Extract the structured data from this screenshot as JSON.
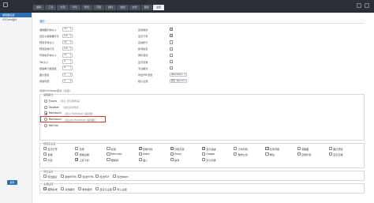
{
  "top_tabs": [
    {
      "label": "编辑",
      "active": false
    },
    {
      "label": "工具",
      "active": false
    },
    {
      "label": "外观",
      "active": false
    },
    {
      "label": "评论",
      "active": false
    },
    {
      "label": "预览",
      "active": false
    },
    {
      "label": "高级",
      "active": false
    },
    {
      "label": "插件",
      "active": false
    },
    {
      "label": "快捷",
      "active": false
    },
    {
      "label": "文件",
      "active": false
    },
    {
      "label": "图床",
      "active": false
    },
    {
      "label": "设置",
      "active": true
    }
  ],
  "sidebar": {
    "items": [
      "编辑器设置",
      "VSCode插件"
    ]
  },
  "main": {
    "section_title": "通用",
    "left_fields": [
      {
        "label": "编辑器字体大小",
        "value": "14"
      },
      {
        "label": "自定义编辑器行高",
        "value": "1.6"
      },
      {
        "label": "预览字体大小",
        "value": "14"
      },
      {
        "label": "预览区域行高",
        "value": "1.6"
      },
      {
        "label": "代码块字体大小",
        "value": "13"
      },
      {
        "label": "Tab大小",
        "value": "4"
      },
      {
        "label": "表格单元格宽度",
        "value": "0"
      },
      {
        "label": "图片宽度",
        "value": "0"
      },
      {
        "label": "表格列宽",
        "value": "0"
      }
    ],
    "right_fields": [
      {
        "label": "自动保存",
        "type": "check",
        "checked": true
      },
      {
        "label": "显示行号",
        "type": "check",
        "checked": true
      },
      {
        "label": "自动折行",
        "type": "check",
        "checked": false
      },
      {
        "label": "拼写检查",
        "type": "check",
        "checked": false
      },
      {
        "label": "同步滚动",
        "type": "check",
        "checked": false
      },
      {
        "label": "显示目录",
        "type": "check",
        "checked": false
      },
      {
        "label": "专注模式",
        "type": "check",
        "checked": false
      },
      {
        "label": "导出PDF纸张",
        "type": "select",
        "value": "Markdown"
      },
      {
        "label": "默认主题",
        "type": "select",
        "value": "默认 Typora"
      }
    ],
    "note": "选择Markdown模式（必选）",
    "mode_legend": "编辑模式",
    "modes": [
      {
        "name": "Typora",
        "desc": "（默认 所见即所得）",
        "selected": false
      },
      {
        "name": "Obsidian",
        "desc": "（双栏实时预览）",
        "selected": false
      },
      {
        "name": "Markdown",
        "desc": "（默认 Markdown 编辑器）",
        "selected": true
      },
      {
        "name": "Markdown",
        "desc": "（纯文本 Markdown 编辑器）",
        "selected": false
      },
      {
        "name": "WeChat",
        "desc": "",
        "selected": false
      }
    ],
    "options_legend": "预览区设置",
    "options": [
      {
        "label": "显示行号",
        "checked": false
      },
      {
        "label": "目录",
        "checked": false
      },
      {
        "label": "标题",
        "checked": false
      },
      {
        "label": "复制代码",
        "checked": true
      },
      {
        "label": "代码高亮",
        "checked": true
      },
      {
        "label": "显示语言",
        "checked": true
      },
      {
        "label": "行内代码",
        "checked": false
      },
      {
        "label": "任务列表",
        "checked": true
      },
      {
        "label": "流程图",
        "checked": false
      },
      {
        "label": "图片预览",
        "checked": false
      },
      {
        "label": "表格",
        "checked": false
      },
      {
        "label": "表格边框",
        "checked": false
      },
      {
        "label": "Mermaid",
        "checked": false
      },
      {
        "label": "Katex",
        "checked": false
      },
      {
        "label": "Emoji",
        "checked": false
      },
      {
        "label": "Google",
        "checked": false
      },
      {
        "label": "数学公式",
        "checked": false
      },
      {
        "label": "脚注",
        "checked": false
      },
      {
        "label": "目录折叠",
        "checked": false
      },
      {
        "label": "显示空格",
        "checked": false
      },
      {
        "label": "高亮",
        "checked": false
      },
      {
        "label": "上标下标",
        "checked": true
      },
      {
        "label": "删除线",
        "checked": false
      },
      {
        "label": "插入",
        "checked": false
      },
      {
        "label": "缩写",
        "checked": false
      },
      {
        "label": "定义列表",
        "checked": false
      }
    ],
    "export_legend": "导出设置",
    "export_options": [
      {
        "label": "导出图片",
        "checked": false
      },
      {
        "label": "复制HTML",
        "checked": false
      },
      {
        "label": "导出HTML",
        "checked": false
      },
      {
        "label": "导出PDF",
        "checked": false
      },
      {
        "label": "导出Word",
        "checked": false
      }
    ],
    "theme_legend": "主题设置",
    "theme_options": [
      {
        "label": "跟随系统",
        "checked": true
      },
      {
        "label": "亮色模式",
        "checked": false
      },
      {
        "label": "暗色模式",
        "checked": false
      },
      {
        "label": "自定义主题",
        "checked": false
      },
      {
        "label": "导入主题",
        "checked": false
      }
    ],
    "confirm_label": "保存"
  },
  "colors": {
    "topbar": "#2b2f36",
    "accent": "#2d6fb3",
    "highlight_border": "#d6362c"
  }
}
